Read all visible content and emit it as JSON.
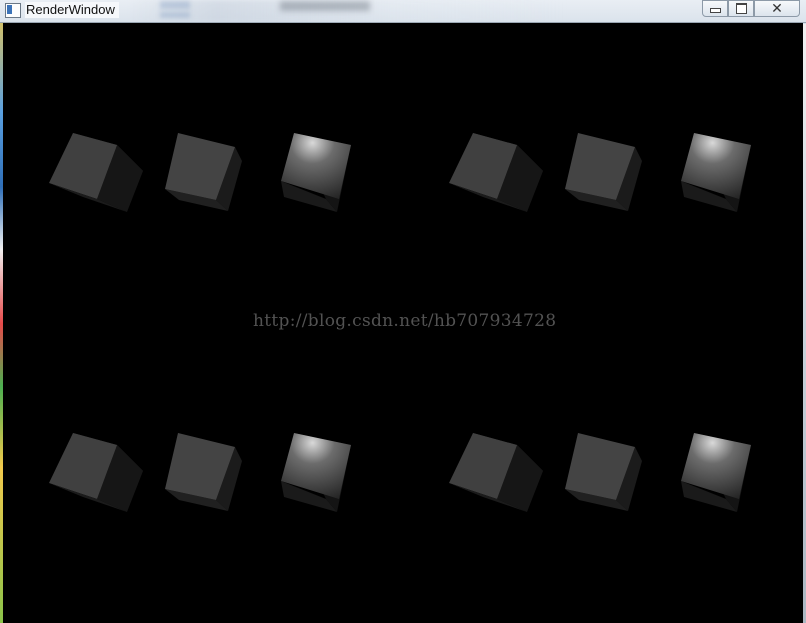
{
  "window": {
    "title": "RenderWindow",
    "controls": [
      "minimize",
      "maximize",
      "close"
    ],
    "close_glyph": "✕"
  },
  "render": {
    "background": "#000000",
    "cube_groups": [
      {
        "name": "top-left"
      },
      {
        "name": "top-right"
      },
      {
        "name": "bottom-left"
      },
      {
        "name": "bottom-right"
      }
    ],
    "cube_shading": [
      "flat",
      "gouraud",
      "specular"
    ]
  },
  "watermark": {
    "text": "http://blog.csdn.net/hb707934728"
  }
}
